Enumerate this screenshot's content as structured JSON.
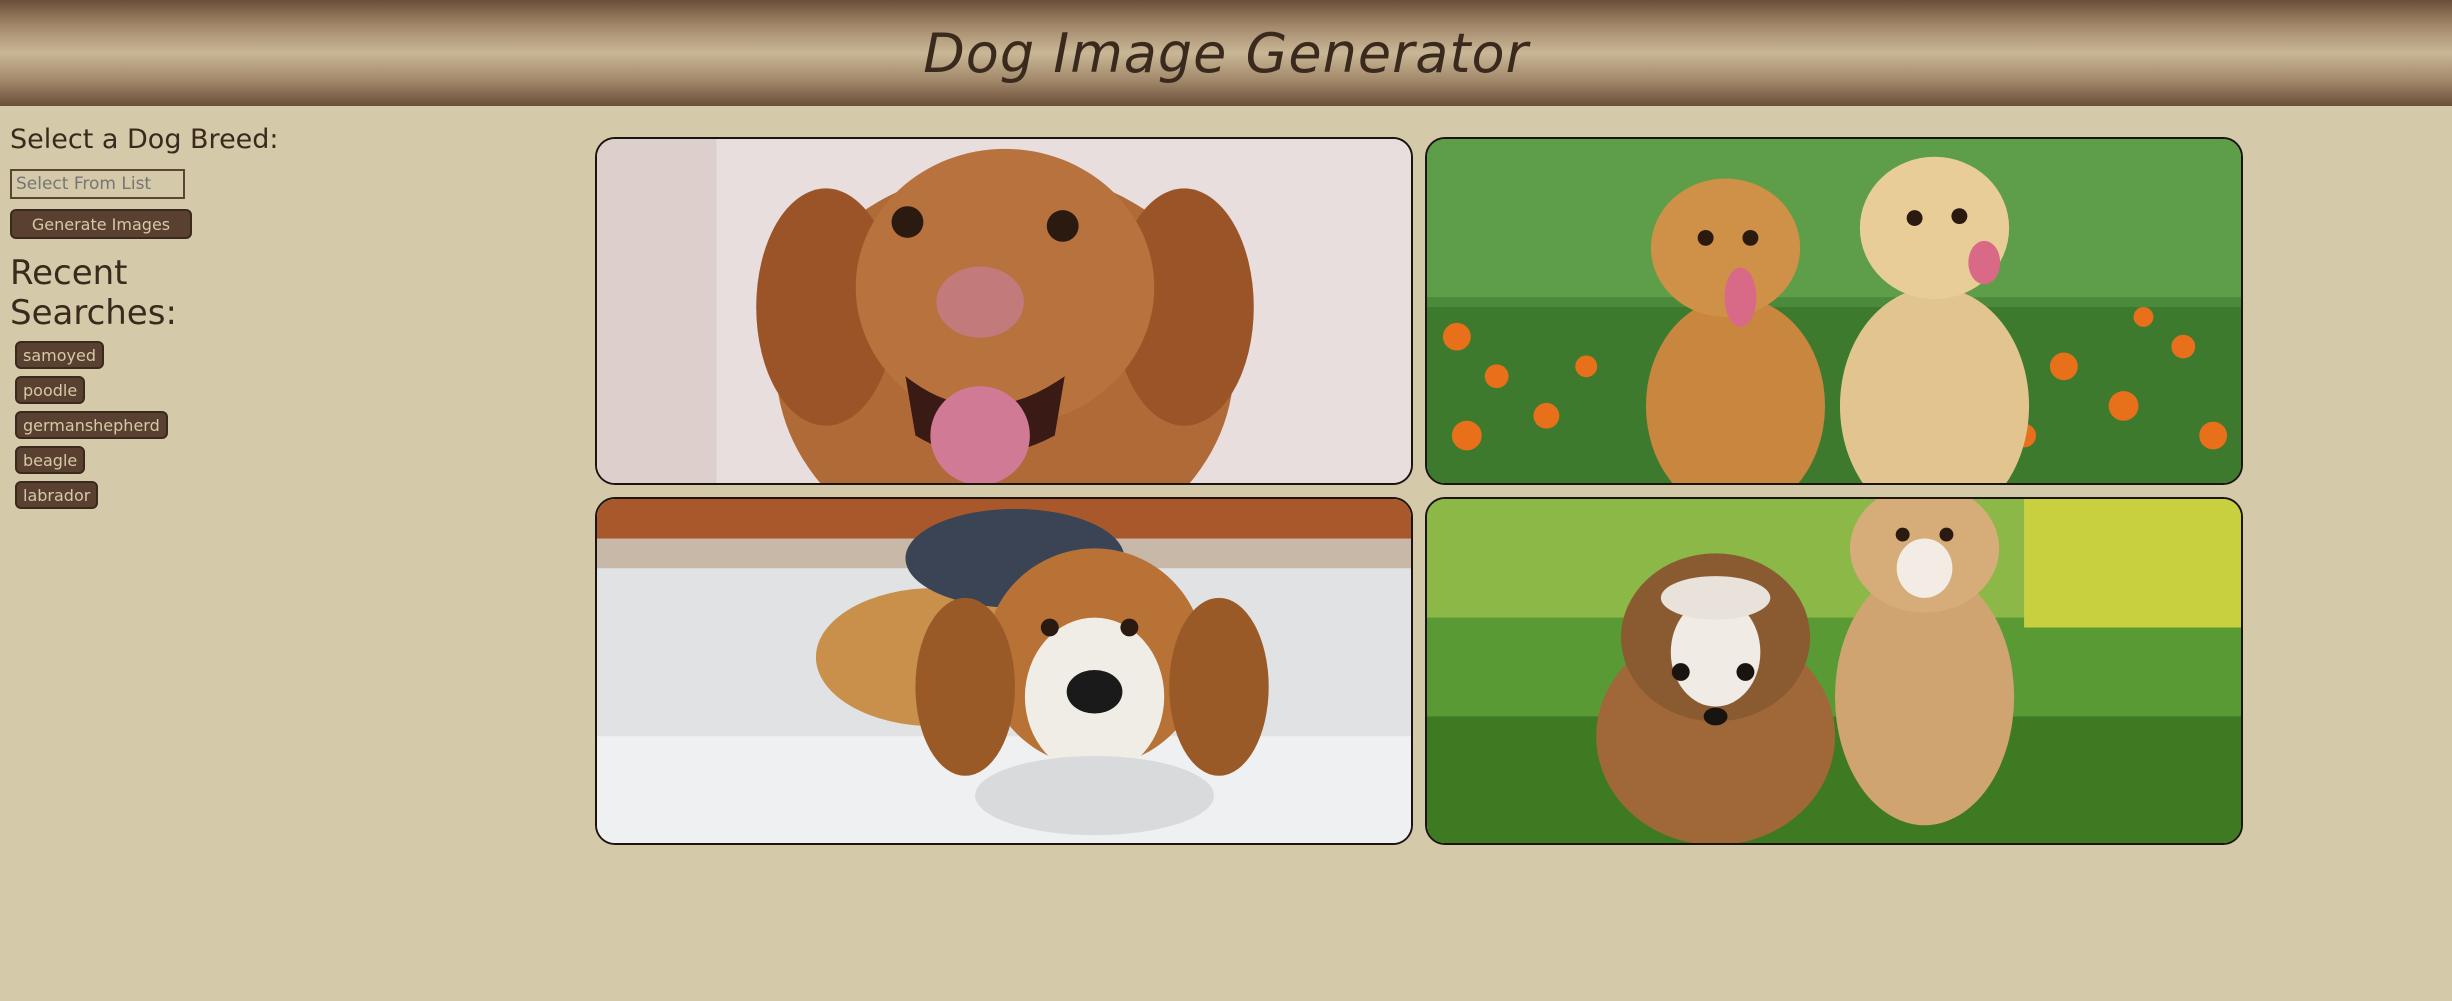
{
  "header": {
    "title": "Dog Image Generator"
  },
  "sidebar": {
    "select_label": "Select a Dog Breed:",
    "breed_input_placeholder": "Select From List",
    "generate_button": "Generate Images",
    "recent_title": "Recent Searches:",
    "recent_items": [
      "samoyed",
      "poodle",
      "germanshepherd",
      "beagle",
      "labrador"
    ]
  },
  "colors": {
    "background": "#d4c9a8",
    "header_dark": "#6b4f3a",
    "button_bg": "#5a4030",
    "button_text": "#d4c9a8",
    "text": "#3a2a1e"
  }
}
